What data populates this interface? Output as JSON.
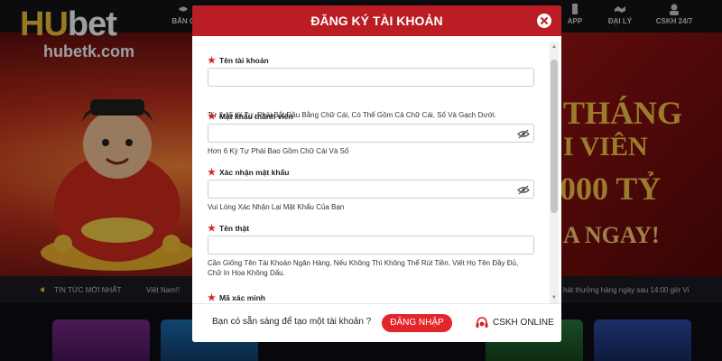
{
  "brand": {
    "logo_main_left": "HU",
    "logo_main_right": "bet",
    "logo_sub": "hubetk.com"
  },
  "nav": [
    {
      "label": "BẮN C",
      "icon": "fish-icon"
    },
    {
      "label": "APP",
      "icon": "phone-icon"
    },
    {
      "label": "ĐẠI LÝ",
      "icon": "handshake-icon"
    },
    {
      "label": "CSKH 24/7",
      "icon": "support-icon"
    }
  ],
  "promo": {
    "line1": "THÁNG",
    "line2": "I VIÊN",
    "line3": "000 TỶ",
    "line4": "A NGAY!"
  },
  "ticker": {
    "left": "TIN TỨC MỚI NHẤT",
    "left2": "Việt Nam!!",
    "right": "hát thưởng hàng ngày sau 14:00 giờ Vi"
  },
  "modal": {
    "title": "ĐĂNG KÝ TÀI KHOẢN",
    "fields": [
      {
        "label": "Tên tài khoản",
        "hint": "Từ 2-15 Kí Tự, Phải Bắt Đầu Bằng Chữ Cái, Có Thể Gồm Cả Chữ Cái, Số Và Gạch Dưới.",
        "value": "",
        "password": false
      },
      {
        "label": "Mật khẩu thành viên",
        "hint": "Hơn 6 Ký Tự Phải Bao Gồm Chữ Cái Và Số",
        "value": "",
        "password": true
      },
      {
        "label": "Xác nhận mật khẩu",
        "hint": "Vui Lòng Xác Nhận Lại Mật Khẩu Của Bạn",
        "value": "",
        "password": true
      },
      {
        "label": "Tên thật",
        "hint": "Cần Giống Tên Tài Khoản Ngân Hàng. Nếu Không Thì Không Thể Rút Tiền. Viết Họ Tên Đầy Đủ, Chữ In Hoa Không Dấu.",
        "value": "",
        "password": false
      },
      {
        "label": "Mã xác minh",
        "hint": "",
        "value": "",
        "password": false
      }
    ],
    "footer": {
      "question": "Bạn có sẵn sàng để tạo một tài khoản ?",
      "login_label": "ĐĂNG NHẬP",
      "support_label": "CSKH ONLINE"
    }
  },
  "colors": {
    "header_red": "#bb1d24",
    "button_red": "#e4262c",
    "required_star": "#d62020",
    "logo_gold": "#f5c23a"
  }
}
